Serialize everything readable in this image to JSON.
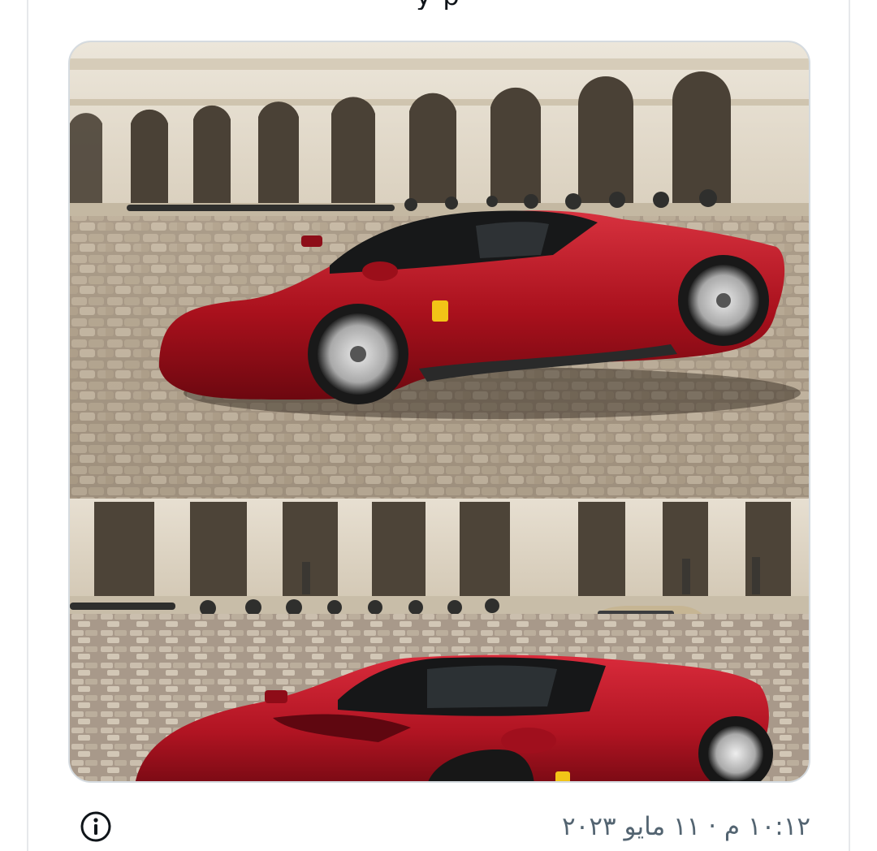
{
  "tweet": {
    "body_text_fragment": "y        p",
    "timestamp": "١٠:١٢ م · ١١ مايو ٢٠٢٣"
  },
  "media": {
    "photos": [
      {
        "id": "ferrari-side-view"
      },
      {
        "id": "ferrari-front-view"
      }
    ]
  },
  "icons": {
    "info": "info-circle-icon"
  },
  "colors": {
    "car_red": "#b3121f",
    "stone": "#e8e0d2",
    "timestamp_gray": "#536471",
    "frame_border": "#d5dbe0"
  }
}
